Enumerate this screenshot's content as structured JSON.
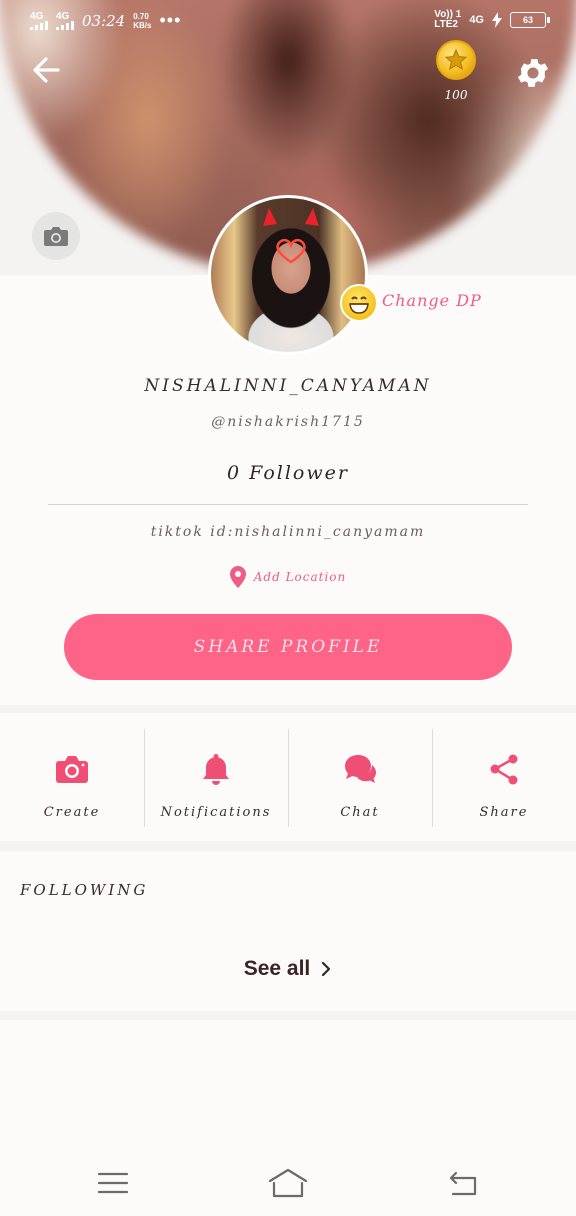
{
  "statusbar": {
    "sim1": "4G",
    "sim2": "4G",
    "time": "03:24",
    "speed_value": "0.70",
    "speed_unit": "KB/s",
    "more": "•••",
    "volte": "Vo)) 1",
    "lte2": "LTE2",
    "net_right": "4G",
    "battery": "63"
  },
  "header": {
    "coins": "100"
  },
  "profile": {
    "change_dp": "Change DP",
    "username": "NISHALINNI_CANYAMAN",
    "handle": "@nishakrish1715",
    "followers": "0 Follower",
    "bio": "tiktok id:nishalinni_canyamam",
    "location": "Add Location",
    "share_button": "SHARE PROFILE"
  },
  "actions": [
    {
      "label": "Create",
      "icon": "camera-icon"
    },
    {
      "label": "Notifications",
      "icon": "bell-icon"
    },
    {
      "label": "Chat",
      "icon": "chat-icon"
    },
    {
      "label": "Share",
      "icon": "share-icon"
    }
  ],
  "following": {
    "title": "FOLLOWING",
    "see_all": "See all"
  },
  "colors": {
    "accent": "#fe6388",
    "accent_text": "#ef5c85",
    "text_dark": "#3b2a2a"
  }
}
